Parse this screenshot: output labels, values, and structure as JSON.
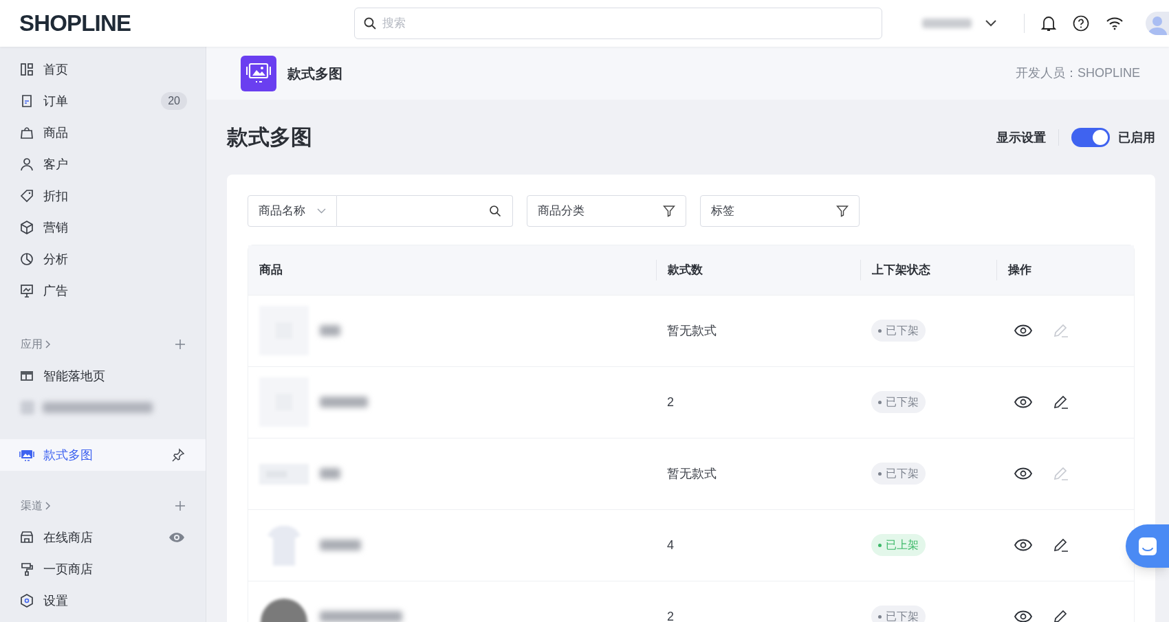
{
  "topbar": {
    "logo": "SHOPLINE",
    "search": {
      "placeholder": "搜索"
    }
  },
  "sidebar": {
    "items": [
      {
        "label": "首页",
        "selected": false
      },
      {
        "label": "订单",
        "selected": false,
        "badge": "20"
      },
      {
        "label": "商品",
        "selected": false
      },
      {
        "label": "客户",
        "selected": false
      },
      {
        "label": "折扣",
        "selected": false
      },
      {
        "label": "营销",
        "selected": false
      },
      {
        "label": "分析",
        "selected": false
      },
      {
        "label": "广告",
        "selected": false
      }
    ],
    "apps": {
      "title": "应用",
      "items": [
        {
          "label": "智能落地页",
          "selected": false
        },
        {
          "label": "款式多图",
          "selected": true
        }
      ]
    },
    "channels": {
      "title": "渠道",
      "items": [
        {
          "label": "在线商店",
          "selected": false
        },
        {
          "label": "一页商店",
          "selected": false
        }
      ]
    },
    "settings": {
      "label": "设置",
      "selected": false
    }
  },
  "app_header": {
    "title": "款式多图",
    "developer": "开发人员：SHOPLINE"
  },
  "page": {
    "title": "款式多图",
    "display_settings": "显示设置",
    "toggle": {
      "on": true,
      "label": "已启用"
    }
  },
  "filters": {
    "field_select": "商品名称",
    "category": "商品分类",
    "tags": "标签"
  },
  "table": {
    "columns": [
      "商品",
      "款式数",
      "上下架状态",
      "操作"
    ],
    "rows": [
      {
        "variants": "暂无款式",
        "status": "已下架",
        "listed": false,
        "edit_disabled": true
      },
      {
        "variants": "2",
        "status": "已下架",
        "listed": false,
        "edit_disabled": false
      },
      {
        "variants": "暂无款式",
        "status": "已下架",
        "listed": false,
        "edit_disabled": true
      },
      {
        "variants": "4",
        "status": "已上架",
        "listed": true,
        "edit_disabled": false
      },
      {
        "variants": "2",
        "status": "已下架",
        "listed": false,
        "edit_disabled": false
      }
    ]
  }
}
